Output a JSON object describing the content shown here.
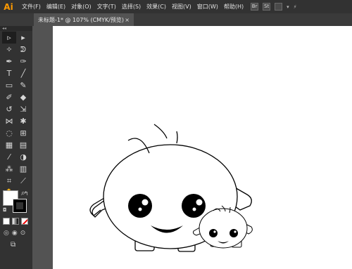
{
  "app": {
    "logo": "Ai"
  },
  "menu": {
    "items": [
      "文件(F)",
      "编辑(E)",
      "对象(O)",
      "文字(T)",
      "选择(S)",
      "效果(C)",
      "视图(V)",
      "窗口(W)",
      "帮助(H)"
    ]
  },
  "menu_icons": {
    "bridge": "Br",
    "stock": "St"
  },
  "document_tab": {
    "title": "未标题-1* @ 107% (CMYK/预览)",
    "close": "×"
  },
  "toolbar": {
    "grip": "◂◂",
    "tools": [
      {
        "icon": "selection-tool-icon",
        "glyph": "▹"
      },
      {
        "icon": "direct-selection-tool-icon",
        "glyph": "▸"
      },
      {
        "icon": "magic-wand-tool-icon",
        "glyph": "✧"
      },
      {
        "icon": "lasso-tool-icon",
        "glyph": "ᕲ"
      },
      {
        "icon": "pen-tool-icon",
        "glyph": "✒"
      },
      {
        "icon": "curvature-tool-icon",
        "glyph": "✑"
      },
      {
        "icon": "type-tool-icon",
        "glyph": "T"
      },
      {
        "icon": "line-segment-tool-icon",
        "glyph": "╱"
      },
      {
        "icon": "rectangle-tool-icon",
        "glyph": "▭"
      },
      {
        "icon": "paintbrush-tool-icon",
        "glyph": "✎"
      },
      {
        "icon": "shaper-tool-icon",
        "glyph": "✐"
      },
      {
        "icon": "eraser-tool-icon",
        "glyph": "◆"
      },
      {
        "icon": "rotate-tool-icon",
        "glyph": "↺"
      },
      {
        "icon": "scale-tool-icon",
        "glyph": "⇲"
      },
      {
        "icon": "width-tool-icon",
        "glyph": "⋈"
      },
      {
        "icon": "puppet-warp-tool-icon",
        "glyph": "✱"
      },
      {
        "icon": "shape-builder-tool-icon",
        "glyph": "◌"
      },
      {
        "icon": "perspective-grid-tool-icon",
        "glyph": "⊞"
      },
      {
        "icon": "mesh-tool-icon",
        "glyph": "▦"
      },
      {
        "icon": "gradient-tool-icon",
        "glyph": "▤"
      },
      {
        "icon": "eyedropper-tool-icon",
        "glyph": "⁄"
      },
      {
        "icon": "blend-tool-icon",
        "glyph": "◑"
      },
      {
        "icon": "symbol-sprayer-tool-icon",
        "glyph": "⁂"
      },
      {
        "icon": "column-graph-tool-icon",
        "glyph": "▥"
      },
      {
        "icon": "artboard-tool-icon",
        "glyph": "⌗"
      },
      {
        "icon": "slice-tool-icon",
        "glyph": "⟋"
      },
      {
        "icon": "hand-tool-icon",
        "glyph": "✋"
      },
      {
        "icon": "zoom-tool-icon",
        "glyph": "⌕"
      }
    ]
  },
  "colors": {
    "fill": "#ffffff",
    "stroke": "#000000",
    "swap_glyph": "↰",
    "default_glyph": "◘",
    "mode_glyphs": [
      "◎",
      "◉",
      "⊙"
    ],
    "screen_mode_glyph": "⧉"
  }
}
